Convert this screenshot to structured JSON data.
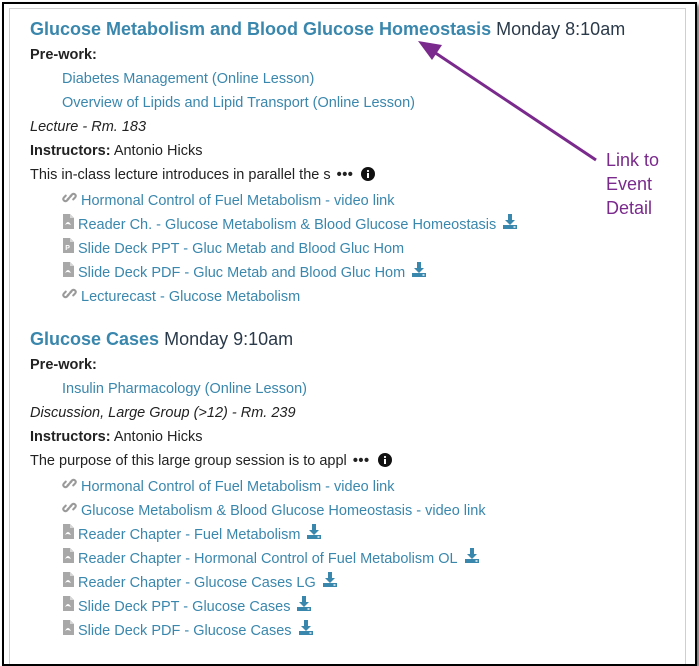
{
  "events": [
    {
      "title": "Glucose Metabolism and Blood Glucose Homeostasis",
      "time": "Monday 8:10am",
      "prework_label": "Pre-work:",
      "prework": [
        "Diabetes Management (Online Lesson)",
        "Overview of Lipids and Lipid Transport (Online Lesson)"
      ],
      "session_type": "Lecture - Rm. 183",
      "instructors_label": "Instructors:",
      "instructors": "Antonio Hicks",
      "description": "This in-class lecture introduces in parallel the s",
      "more": "•••",
      "resources": [
        {
          "label": "Hormonal Control of Fuel Metabolism - video link",
          "icon": "link-icon",
          "download": false
        },
        {
          "label": "Reader Ch. - Glucose Metabolism & Blood Glucose Homeostasis",
          "icon": "pdf-file-icon",
          "download": true
        },
        {
          "label": "Slide Deck PPT - Gluc Metab and Blood Gluc Hom",
          "icon": "ppt-file-icon",
          "download": false
        },
        {
          "label": "Slide Deck PDF - Gluc Metab and Blood Gluc Hom",
          "icon": "pdf-file-icon",
          "download": true
        },
        {
          "label": "Lecturecast - Glucose Metabolism",
          "icon": "link-icon",
          "download": false
        }
      ]
    },
    {
      "title": "Glucose Cases",
      "time": "Monday 9:10am",
      "prework_label": "Pre-work:",
      "prework": [
        "Insulin Pharmacology (Online Lesson)"
      ],
      "session_type": "Discussion, Large Group (>12) - Rm. 239",
      "instructors_label": "Instructors:",
      "instructors": "Antonio Hicks",
      "description": "The purpose of this large group session is to appl",
      "more": "•••",
      "resources": [
        {
          "label": "Hormonal Control of Fuel Metabolism - video link",
          "icon": "link-icon",
          "download": false
        },
        {
          "label": "Glucose Metabolism & Blood Glucose Homeostasis - video link",
          "icon": "link-icon",
          "download": false
        },
        {
          "label": "Reader Chapter - Fuel Metabolism",
          "icon": "pdf-file-icon",
          "download": true
        },
        {
          "label": "Reader Chapter - Hormonal Control of Fuel Metabolism OL",
          "icon": "pdf-file-icon",
          "download": true
        },
        {
          "label": "Reader Chapter - Glucose Cases LG",
          "icon": "pdf-file-icon",
          "download": true
        },
        {
          "label": "Slide Deck PPT - Glucose Cases",
          "icon": "pdf-file-icon",
          "download": true
        },
        {
          "label": "Slide Deck PDF - Glucose Cases",
          "icon": "pdf-file-icon",
          "download": true
        }
      ]
    }
  ],
  "annotation": {
    "lines": [
      "Link to",
      "Event",
      "Detail"
    ]
  },
  "colors": {
    "link": "#3a87ad",
    "annotation": "#7a2a8c",
    "icon_gray": "#9a9a9a"
  }
}
